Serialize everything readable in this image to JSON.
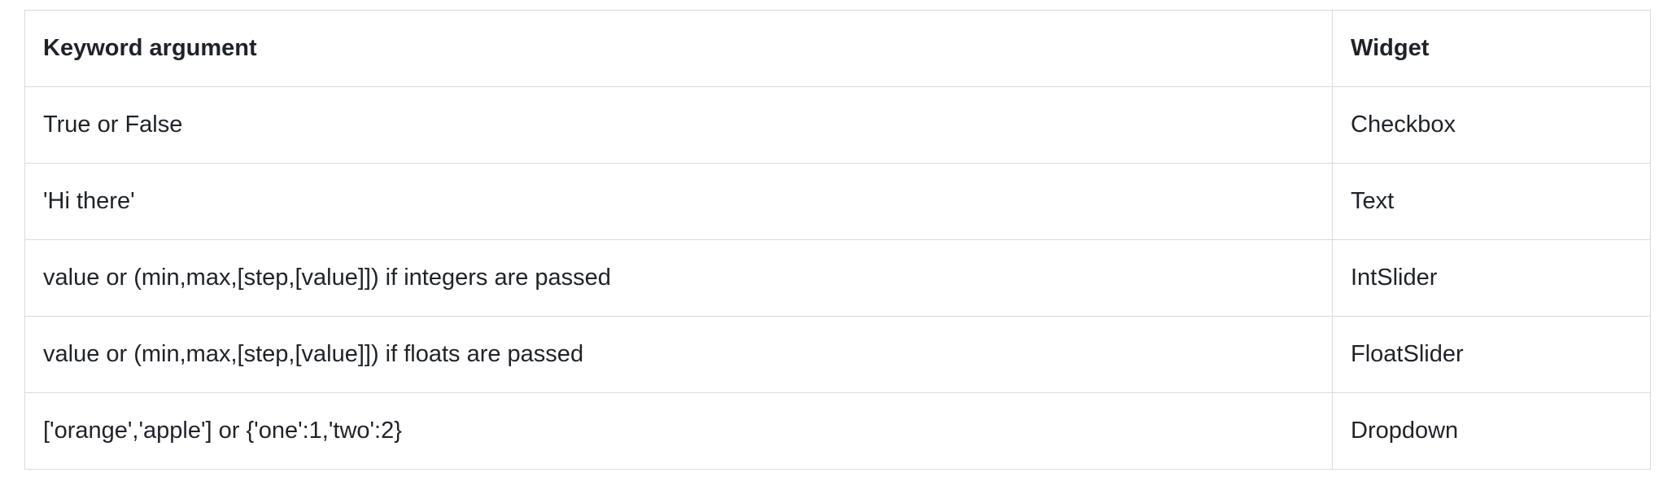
{
  "table": {
    "headers": [
      "Keyword argument",
      "Widget"
    ],
    "rows": [
      [
        "True or False",
        "Checkbox"
      ],
      [
        "'Hi there'",
        "Text"
      ],
      [
        "value or (min,max,[step,[value]]) if integers are passed",
        "IntSlider"
      ],
      [
        "value or (min,max,[step,[value]]) if floats are passed",
        "FloatSlider"
      ],
      [
        "['orange','apple'] or {'one':1,'two':2}",
        "Dropdown"
      ]
    ]
  },
  "colors": {
    "border": "#d8dbe0",
    "text": "#1f2328",
    "background": "#ffffff"
  }
}
